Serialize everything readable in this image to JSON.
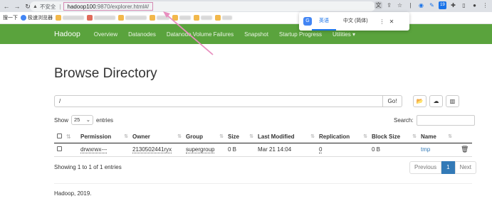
{
  "browser": {
    "insecure_label": "不安全",
    "url_host": "hadoop100",
    "url_rest": ":9870/explorer.html#/",
    "bookmarks": [
      {
        "label": "搜一下"
      },
      {
        "label": "极速浏览器"
      }
    ]
  },
  "translate_popup": {
    "tab_english": "英语",
    "tab_chinese": "中文 (简体)"
  },
  "navbar": {
    "brand": "Hadoop",
    "links": [
      "Overview",
      "Datanodes",
      "Datanode Volume Failures",
      "Snapshot",
      "Startup Progress",
      "Utilities ▾"
    ]
  },
  "page": {
    "title": "Browse Directory",
    "path_value": "/",
    "go_label": "Go!",
    "show_label": "Show",
    "entries_value": "25",
    "entries_label": "entries",
    "search_label": "Search:"
  },
  "table": {
    "headers": [
      "Permission",
      "Owner",
      "Group",
      "Size",
      "Last Modified",
      "Replication",
      "Block Size",
      "Name"
    ],
    "rows": [
      {
        "permission": "drwxrwx---",
        "owner": "2130502441ryx",
        "group": "supergroup",
        "size": "0 B",
        "last_modified": "Mar 21 14:04",
        "replication": "0",
        "block_size": "0 B",
        "name": "tmp"
      }
    ]
  },
  "info": "Showing 1 to 1 of 1 entries",
  "pager": {
    "previous": "Previous",
    "page": "1",
    "next": "Next"
  },
  "footer": "Hadoop, 2019.",
  "colors": {
    "navbar": "#5aa33d",
    "link": "#337ab7",
    "annotation": "#e88fbf"
  }
}
